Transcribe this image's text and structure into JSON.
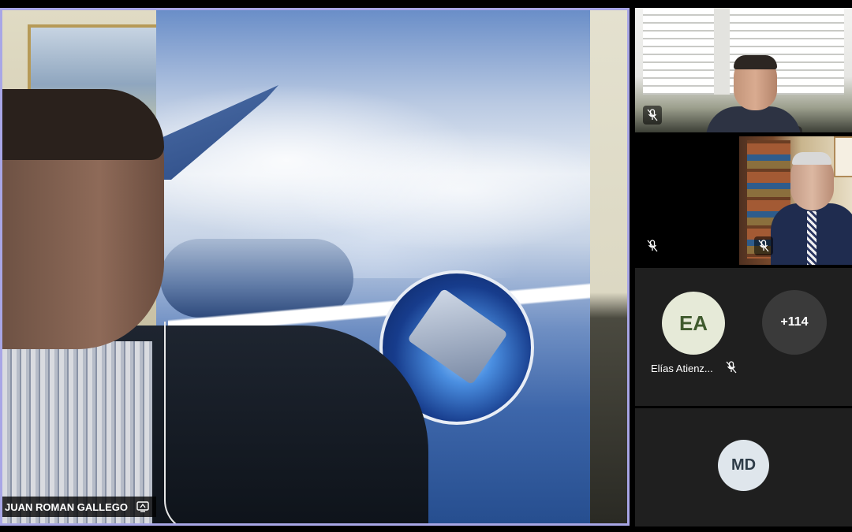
{
  "main_speaker": {
    "name": "JUAN ROMAN GALLEGO",
    "status_icon": "screen-share-icon"
  },
  "participants": {
    "tile1": {
      "mic_icon": "mic-off-icon"
    },
    "tile2": {
      "mic_icon": "mic-off-icon"
    },
    "tile3": {
      "avatar_initials": "EA",
      "name": "Elías Atienz...",
      "mic_icon": "mic-off-icon",
      "overflow_count": "+114"
    },
    "tile4": {
      "avatar_initials": "MD"
    }
  },
  "colors": {
    "active_speaker_border": "#a8a6e6",
    "tile_background": "#1f1f1f"
  }
}
